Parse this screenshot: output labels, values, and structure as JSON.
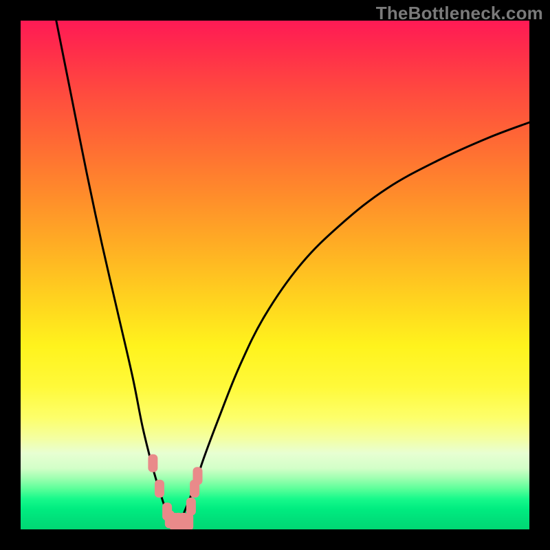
{
  "attribution": "TheBottleneck.com",
  "colors": {
    "frame": "#000000",
    "curve": "#000000",
    "marker_fill": "#e98a8a",
    "marker_stroke": "#c46a6a",
    "gradient_top": "#ff1a55",
    "gradient_bottom": "#00d873"
  },
  "chart_data": {
    "type": "line",
    "title": "",
    "xlabel": "",
    "ylabel": "",
    "xlim": [
      0,
      100
    ],
    "ylim": [
      0,
      100
    ],
    "series": [
      {
        "name": "left-branch",
        "x": [
          7,
          10,
          13,
          16,
          19,
          22,
          24,
          26,
          27.5,
          28.5,
          29.5,
          30.5
        ],
        "y": [
          100,
          85,
          70,
          56,
          43,
          30,
          20,
          12,
          7,
          4,
          2,
          0
        ]
      },
      {
        "name": "right-branch",
        "x": [
          30.5,
          32,
          34,
          36,
          39,
          43,
          48,
          55,
          63,
          72,
          82,
          92,
          100
        ],
        "y": [
          0,
          3,
          8,
          14,
          22,
          32,
          42,
          52,
          60,
          67,
          72.5,
          77,
          80
        ]
      }
    ],
    "markers": {
      "name": "highlight-points",
      "points": [
        {
          "x": 26.0,
          "y": 13.0
        },
        {
          "x": 27.3,
          "y": 8.0
        },
        {
          "x": 28.8,
          "y": 3.5
        },
        {
          "x": 29.3,
          "y": 2.0
        },
        {
          "x": 30.2,
          "y": 1.5
        },
        {
          "x": 31.0,
          "y": 1.5
        },
        {
          "x": 32.0,
          "y": 1.5
        },
        {
          "x": 33.0,
          "y": 1.5
        },
        {
          "x": 33.5,
          "y": 4.5
        },
        {
          "x": 34.2,
          "y": 8.0
        },
        {
          "x": 34.8,
          "y": 10.5
        }
      ]
    }
  }
}
